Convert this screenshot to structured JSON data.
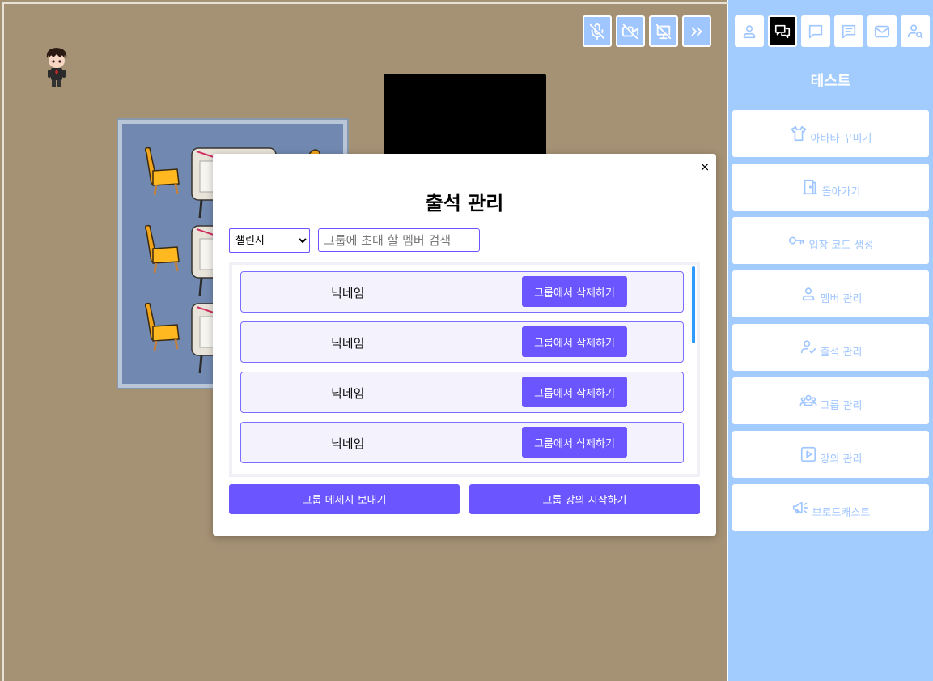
{
  "media_controls": [
    {
      "name": "mic-off-icon"
    },
    {
      "name": "camera-off-icon"
    },
    {
      "name": "screen-share-off-icon"
    },
    {
      "name": "chevrons-right-icon"
    }
  ],
  "modal": {
    "close_label": "×",
    "title": "출석 관리",
    "group_select": {
      "selected": "챌린지",
      "options": [
        "챌린지"
      ]
    },
    "search": {
      "placeholder": "그룹에 초대 할 멤버 검색",
      "value": ""
    },
    "members": [
      {
        "name": "닉네임",
        "action": "그룹에서 삭제하기"
      },
      {
        "name": "닉네임",
        "action": "그룹에서 삭제하기"
      },
      {
        "name": "닉네임",
        "action": "그룹에서 삭제하기"
      },
      {
        "name": "닉네임",
        "action": "그룹에서 삭제하기"
      }
    ],
    "send_message_label": "그룹 메세지 보내기",
    "start_lecture_label": "그룹 강의 시작하기"
  },
  "sidebar": {
    "tabs": [
      {
        "icon": "user-icon",
        "active": false
      },
      {
        "icon": "chat-bubbles-icon",
        "active": true
      },
      {
        "icon": "message-icon",
        "active": false
      },
      {
        "icon": "message-lines-icon",
        "active": false
      },
      {
        "icon": "mail-icon",
        "active": false
      },
      {
        "icon": "user-search-icon",
        "active": false
      }
    ],
    "title": "테스트",
    "menu": [
      {
        "label": "아바타 꾸미기",
        "icon": "tshirt-icon"
      },
      {
        "label": "돌아가기",
        "icon": "door-icon"
      },
      {
        "label": "입장 코드 생성",
        "icon": "key-icon"
      },
      {
        "label": "멤버 관리",
        "icon": "user-icon"
      },
      {
        "label": "출석 관리",
        "icon": "user-check-icon"
      },
      {
        "label": "그룹 관리",
        "icon": "users-icon"
      },
      {
        "label": "강의 관리",
        "icon": "play-icon"
      },
      {
        "label": "브로드캐스트",
        "icon": "megaphone-icon"
      }
    ]
  },
  "colors": {
    "accent": "#6b55ff",
    "sidebar_bg": "#a2ccfd",
    "floor": "#a59174"
  }
}
